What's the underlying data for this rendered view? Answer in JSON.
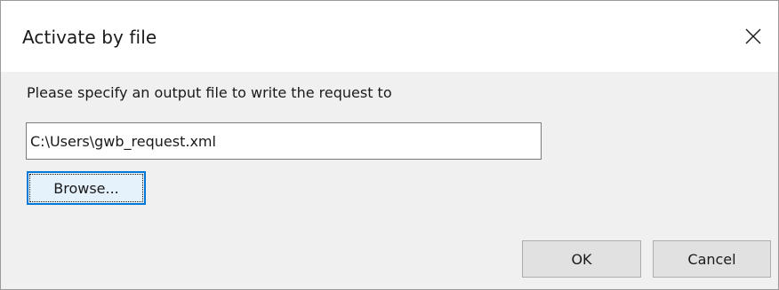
{
  "dialog": {
    "title": "Activate by file",
    "close_icon": "close-icon"
  },
  "prompt": {
    "text": "Please specify an output file to write the request to"
  },
  "output_file": {
    "value": "C:\\Users\\gwb_request.xml"
  },
  "buttons": {
    "browse_label": "Browse...",
    "ok_label": "OK",
    "cancel_label": "Cancel"
  },
  "colors": {
    "dialog_background": "#f0f0f0",
    "title_background": "#ffffff",
    "focus_accent": "#0078d7",
    "button_face": "#e1e1e1"
  }
}
